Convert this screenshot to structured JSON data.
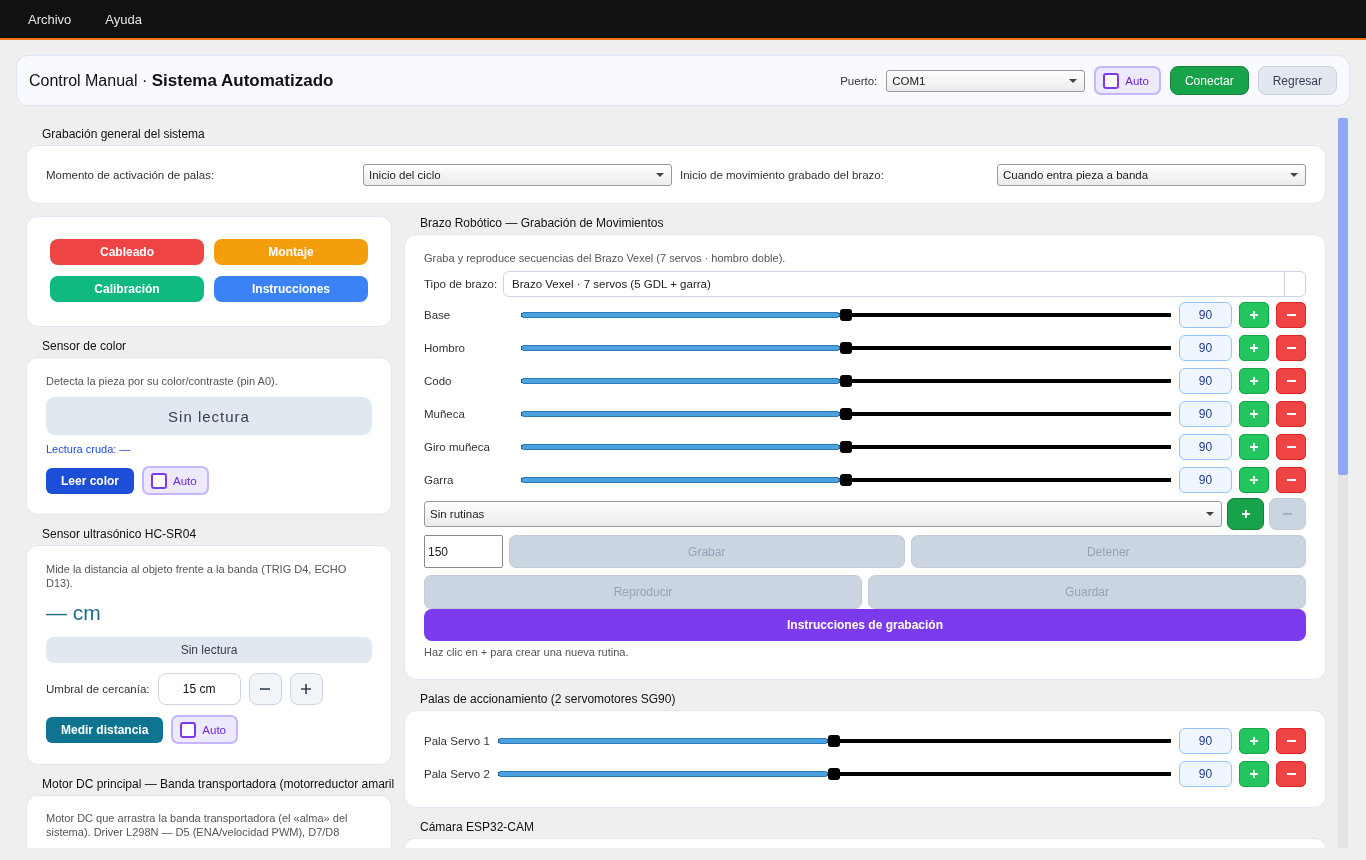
{
  "menu_bar": {
    "items": [
      "Archivo",
      "Ayuda"
    ]
  },
  "header": {
    "title": "Control Manual · **Sistema Automatizado**",
    "port": {
      "label": "Puerto:",
      "value": "COM1"
    },
    "auto_toggle": {
      "label": "Auto",
      "checked": false
    },
    "buttons": [
      {
        "label": "Conectar",
        "kind": "primary"
      },
      {
        "label": "Regresar",
        "kind": "secondary"
      }
    ]
  },
  "general_recording": {
    "title": "Grabación general del sistema",
    "fields": [
      {
        "label": "Momento de activación de palas:",
        "value": "Inicio del ciclo"
      },
      {
        "label": "Inicio de movimiento grabado del brazo:",
        "value": "Cuando entra pieza a banda"
      }
    ]
  },
  "quick_buttons": [
    {
      "label": "Cableado",
      "color": "#ef4444"
    },
    {
      "label": "Montaje",
      "color": "#f59e0b"
    },
    {
      "label": "Calibración",
      "color": "#10b981"
    },
    {
      "label": "Instrucciones",
      "color": "#3b82f6"
    }
  ],
  "color_sensor": {
    "title": "Sensor de color",
    "description": "Detecta la pieza por su color/contraste (pin A0).",
    "reading": "Sin lectura",
    "raw_reading": "Lectura cruda: —",
    "button": "Leer color",
    "auto_toggle": {
      "label": "Auto",
      "checked": false
    }
  },
  "ultrasonic_sensor": {
    "title": "Sensor ultrasónico HC-SR04",
    "description": "Mide la distancia al objeto frente a la banda (TRIG D4, ECHO D13).",
    "distance": "— cm",
    "status": "Sin lectura",
    "threshold": {
      "label": "Umbral de cercanía:",
      "value": "15 cm"
    },
    "button": "Medir distancia",
    "auto_toggle": {
      "label": "Auto",
      "checked": false
    }
  },
  "dc_motor": {
    "title": "Motor DC principal — Banda transportadora (motorreductor amaril",
    "description": "Motor DC que arrastra la banda transportadora (el «alma» del sistema). Driver L298N — D5 (ENA/velocidad PWM), D7/D8"
  },
  "robot_arm": {
    "title": "Brazo Robótico — Grabación de Movimientos",
    "description": "Graba y reproduce secuencias del Brazo Vexel (7 servos · hombro doble).",
    "arm_type": {
      "label": "Tipo de brazo:",
      "value": "Brazo Vexel · 7 servos (5 GDL + garra)"
    },
    "servos": [
      {
        "name": "Base",
        "level": 0.5,
        "value": "90"
      },
      {
        "name": "Hombro",
        "level": 0.5,
        "value": "90"
      },
      {
        "name": "Codo",
        "level": 0.5,
        "value": "90"
      },
      {
        "name": "Muñeca",
        "level": 0.5,
        "value": "90"
      },
      {
        "name": "Giro muñeca",
        "level": 0.5,
        "value": "90"
      },
      {
        "name": "Garra",
        "level": 0.5,
        "value": "90"
      }
    ],
    "routine": {
      "value": "Sin rutinas"
    },
    "routine_buttons": [
      {
        "kind": "add",
        "disabled": false
      },
      {
        "kind": "remove",
        "disabled": true
      }
    ],
    "interval": "150",
    "actions": [
      {
        "label": "Grabar",
        "disabled": true
      },
      {
        "label": "Detener",
        "disabled": true
      },
      {
        "label": "Reproducir",
        "disabled": true
      },
      {
        "label": "Guardar",
        "disabled": true
      }
    ],
    "instructions_button": "Instrucciones de grabación",
    "hint": "Haz clic en + para crear una nueva rutina."
  },
  "paddles": {
    "title": "Palas de accionamiento (2 servomotores SG90)",
    "servos": [
      {
        "name": "Pala Servo 1",
        "level": 0.5,
        "value": "90"
      },
      {
        "name": "Pala Servo 2",
        "level": 0.5,
        "value": "90"
      }
    ]
  },
  "camera": {
    "title": "Cámara ESP32-CAM"
  }
}
